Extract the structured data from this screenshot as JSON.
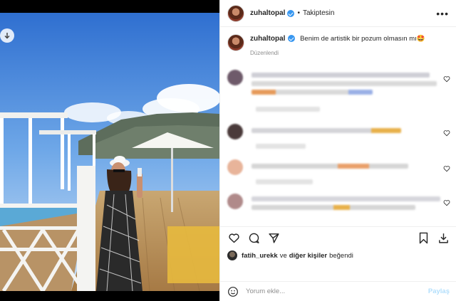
{
  "post": {
    "username": "zuhaltopal",
    "follow_state": "Takiptesin",
    "separator": "•",
    "more_label": "•••",
    "caption_text": "Benim de artistik bir pozum olmasın mı🤩",
    "edited_label": "Düzenlendi"
  },
  "likes": {
    "liker": "fatih_urekk",
    "connector": "ve",
    "others": "diğer kişiler",
    "suffix": "beğendi"
  },
  "comment_box": {
    "placeholder": "Yorum ekle...",
    "post_label": "Paylaş"
  },
  "colors": {
    "verified": "#3897f0",
    "text": "#262626",
    "muted": "#8e8e8e",
    "post_disabled": "#b2dffc"
  },
  "icons": [
    "download-icon",
    "verified-icon",
    "more-icon",
    "heart-icon",
    "comment-icon",
    "share-icon",
    "bookmark-icon",
    "save-download-icon",
    "emoji-icon"
  ]
}
